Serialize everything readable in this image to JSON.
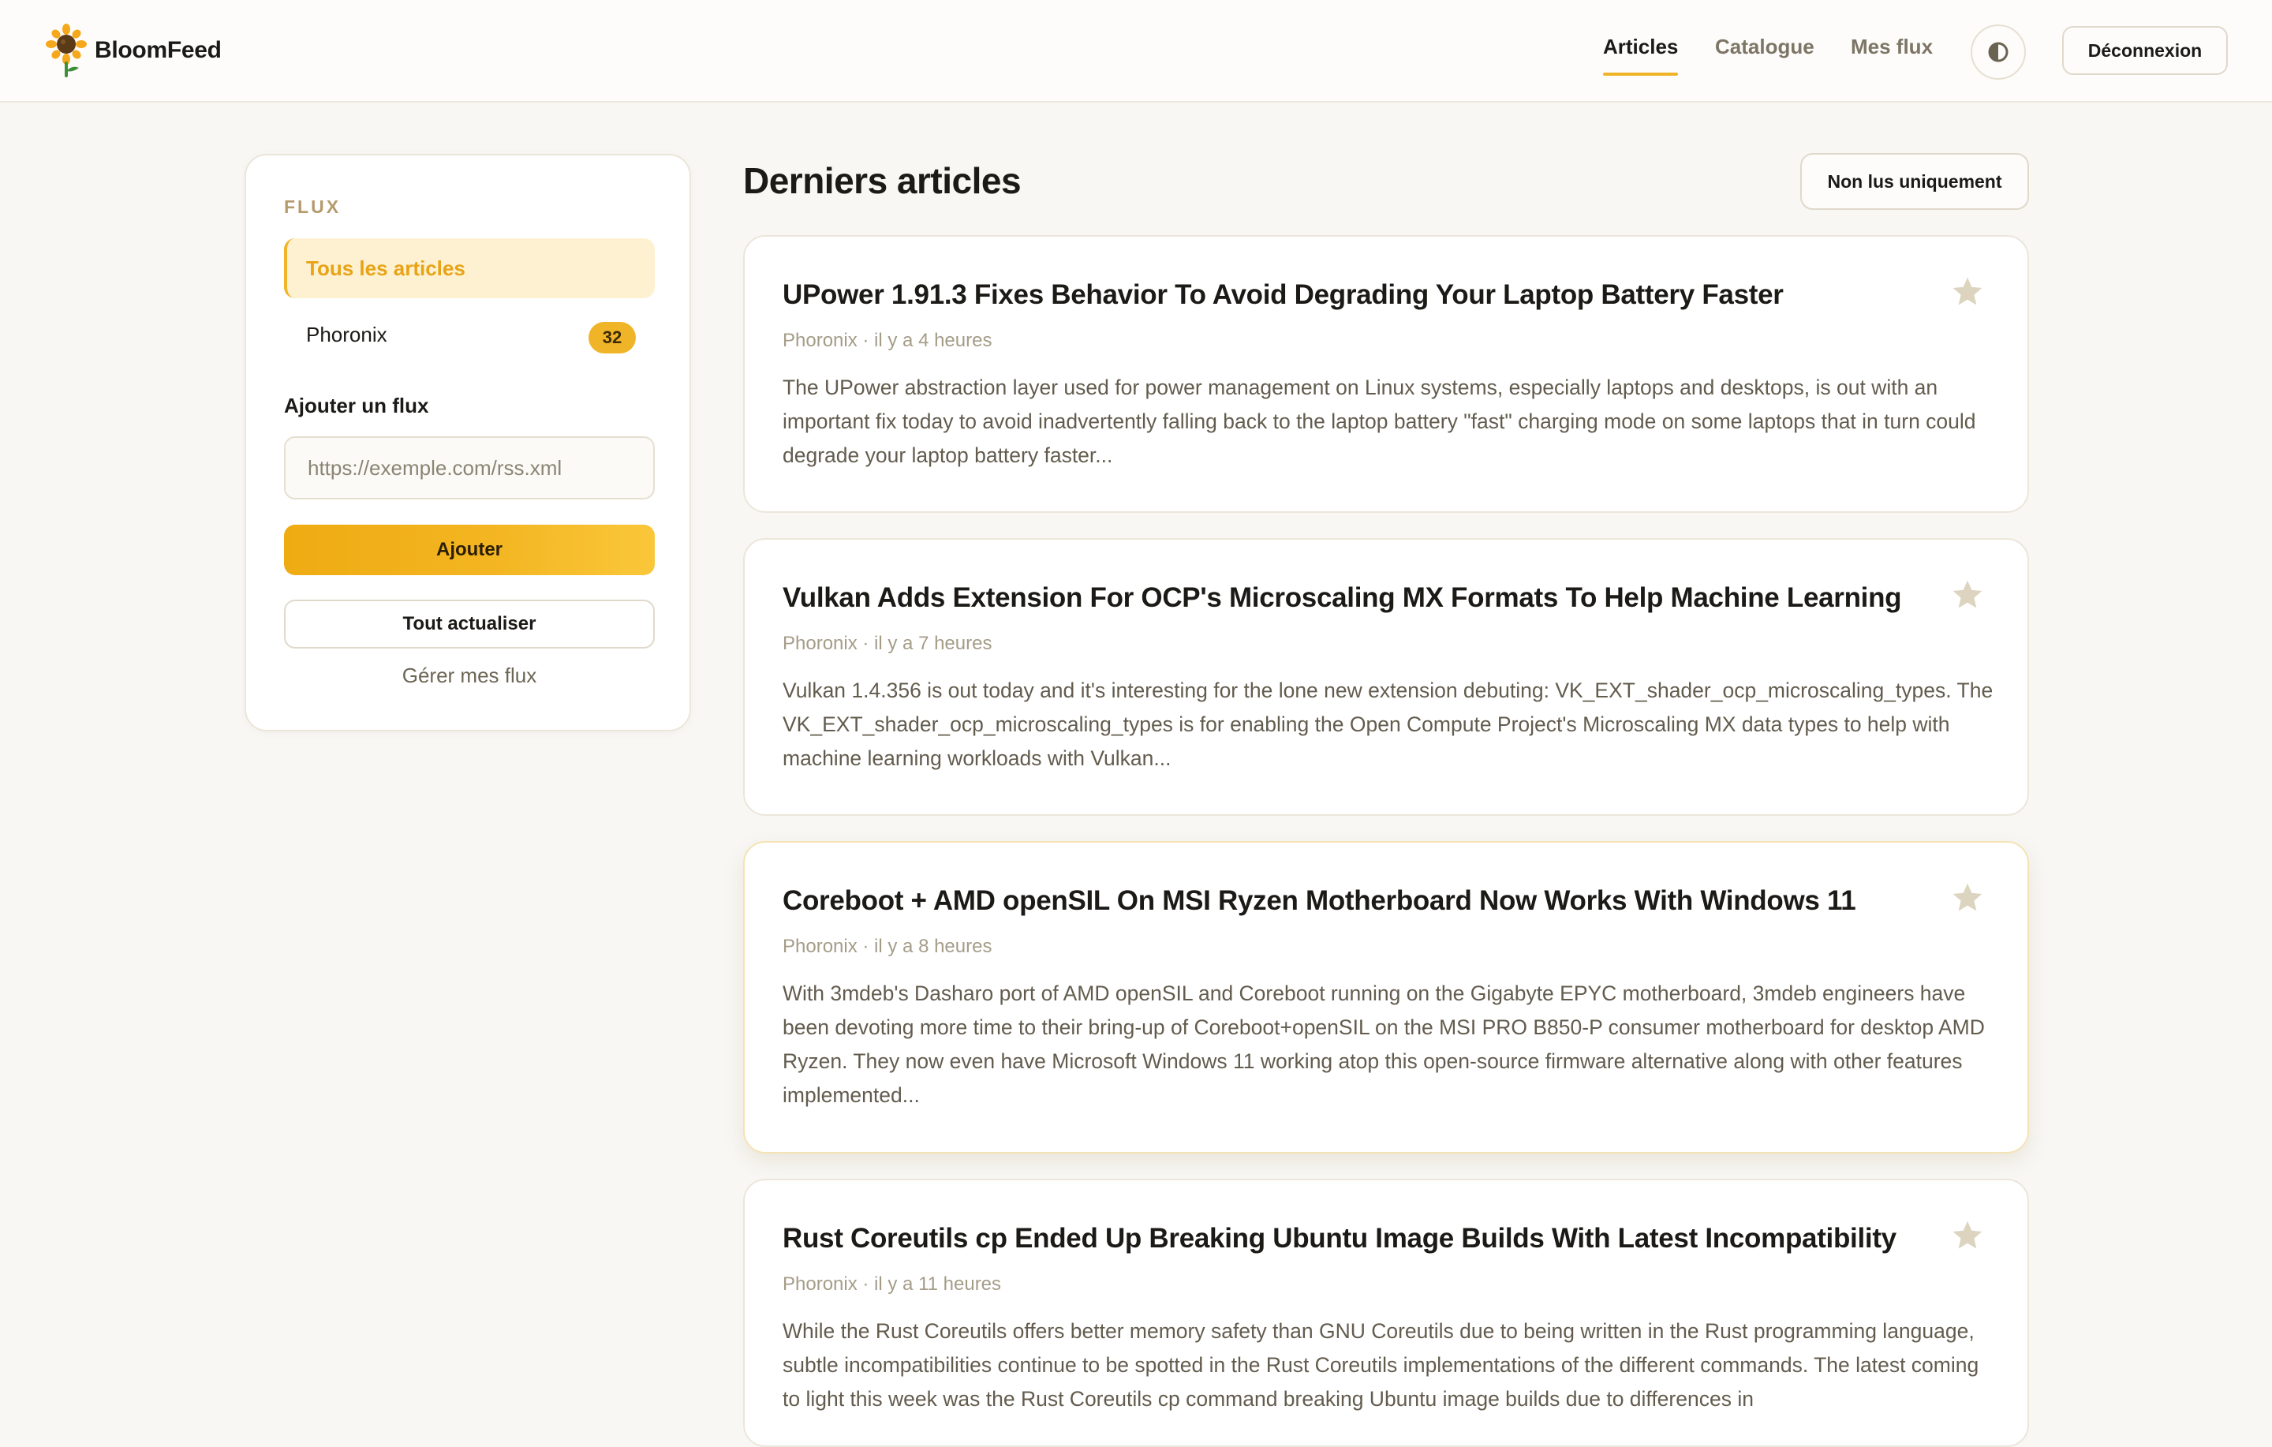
{
  "colors": {
    "accent": "#f0b429",
    "accent_soft": "#fdf1d2",
    "background": "#f8f7f4",
    "star": "#ddd4c0"
  },
  "header": {
    "brand": "BloomFeed",
    "logo_icon": "sunflower-icon",
    "nav": [
      {
        "label": "Articles",
        "active": true
      },
      {
        "label": "Catalogue",
        "active": false
      },
      {
        "label": "Mes flux",
        "active": false
      }
    ],
    "theme_icon": "half-circle-contrast-icon",
    "logout_label": "Déconnexion"
  },
  "sidebar": {
    "heading": "FLUX",
    "all_label": "Tous les articles",
    "feeds": [
      {
        "name": "Phoronix",
        "count": "32"
      }
    ],
    "add_label": "Ajouter un flux",
    "input_placeholder": "https://exemple.com/rss.xml",
    "input_value": "",
    "add_button": "Ajouter",
    "refresh_button": "Tout actualiser",
    "manage_link": "Gérer mes flux"
  },
  "main": {
    "title": "Derniers articles",
    "filter_button": "Non lus uniquement",
    "articles": [
      {
        "title": "UPower 1.91.3 Fixes Behavior To Avoid Degrading Your Laptop Battery Faster",
        "meta": "Phoronix · il y a 4 heures",
        "excerpt": "The UPower abstraction layer used for power management on Linux systems, especially laptops and desktops, is out with an important fix today to avoid inadvertently falling back to the laptop battery \"fast\" charging mode on some laptops that in turn could degrade your laptop battery faster...",
        "starred": false
      },
      {
        "title": "Vulkan Adds Extension For OCP's Microscaling MX Formats To Help Machine Learning",
        "meta": "Phoronix · il y a 7 heures",
        "excerpt": "Vulkan 1.4.356 is out today and it's interesting for the lone new extension debuting: VK_EXT_shader_ocp_microscaling_types. The VK_EXT_shader_ocp_microscaling_types is for enabling the Open Compute Project's Microscaling MX data types to help with machine learning workloads with Vulkan...",
        "starred": false
      },
      {
        "title": "Coreboot + AMD openSIL On MSI Ryzen Motherboard Now Works With Windows 11",
        "meta": "Phoronix · il y a 8 heures",
        "excerpt": "With 3mdeb's Dasharo port of AMD openSIL and Coreboot running on the Gigabyte EPYC motherboard, 3mdeb engineers have been devoting more time to their bring-up of Coreboot+openSIL on the MSI PRO B850-P consumer motherboard for desktop AMD Ryzen. They now even have Microsoft Windows 11 working atop this open-source firmware alternative along with other features implemented...",
        "starred": false
      },
      {
        "title": "Rust Coreutils cp Ended Up Breaking Ubuntu Image Builds With Latest Incompatibility",
        "meta": "Phoronix · il y a 11 heures",
        "excerpt": "While the Rust Coreutils offers better memory safety than GNU Coreutils due to being written in the Rust programming language, subtle incompatibilities continue to be spotted in the Rust Coreutils implementations of the different commands. The latest coming to light this week was the Rust Coreutils cp command breaking Ubuntu image builds due to differences in",
        "starred": false
      }
    ]
  }
}
